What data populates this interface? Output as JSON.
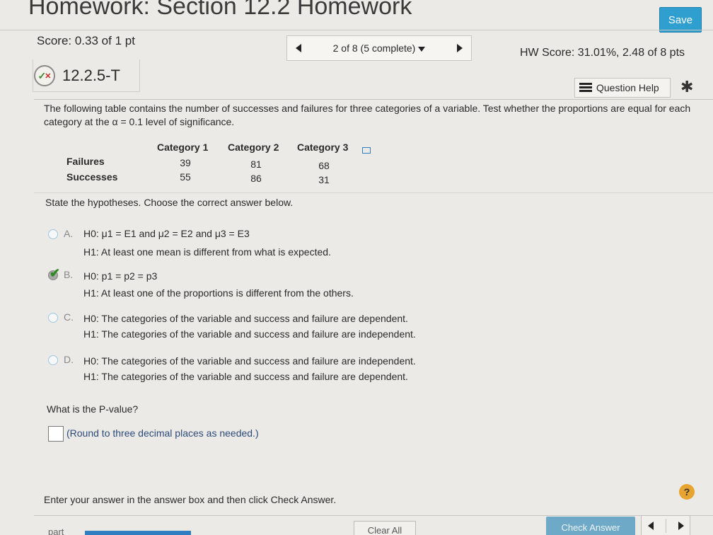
{
  "header": {
    "title": "Homework: Section 12.2 Homework",
    "save_label": "Save"
  },
  "status": {
    "score": "Score: 0.33 of 1 pt",
    "question_nav": "2 of 8 (5 complete)",
    "hw_score": "HW Score: 31.01%, 2.48 of 8 pts"
  },
  "question": {
    "id": "12.2.5-T",
    "help_label": "Question Help",
    "prompt": "The following table contains the number of successes and failures for three categories of a variable. Test whether the proportions are equal for each category at the α = 0.1 level of significance.",
    "table": {
      "columns": [
        "Category 1",
        "Category 2",
        "Category 3"
      ],
      "rows": [
        {
          "label": "Failures",
          "values": [
            "39",
            "81",
            "68"
          ]
        },
        {
          "label": "Successes",
          "values": [
            "55",
            "86",
            "31"
          ]
        }
      ]
    },
    "instruction": "State the hypotheses. Choose the correct answer below.",
    "options": [
      {
        "letter": "A.",
        "h0": "H0: μ1 = E1 and μ2 = E2 and μ3 = E3",
        "h1": "H1: At least one mean is different from what is expected.",
        "selected": false
      },
      {
        "letter": "B.",
        "h0": "H0: p1 = p2 = p3",
        "h1": "H1: At least one of the proportions is different from the others.",
        "selected": true
      },
      {
        "letter": "C.",
        "h0": "H0: The categories of the variable and success and failure are dependent.",
        "h1": "H1: The categories of the variable and success and failure are independent.",
        "selected": false
      },
      {
        "letter": "D.",
        "h0": "H0: The categories of the variable and success and failure are independent.",
        "h1": "H1: The categories of the variable and success and failure are dependent.",
        "selected": false
      }
    ],
    "pvalue_question": "What is the P-value?",
    "pvalue_hint": "(Round to three decimal places as needed.)"
  },
  "footer": {
    "instruction": "Enter your answer in the answer box and then click Check Answer.",
    "part_label": "part",
    "clear_label": "Clear All",
    "check_label": "Check Answer",
    "help_symbol": "?"
  },
  "colors": {
    "accent": "#2f9fd0",
    "check_green": "#2e8a1f",
    "background": "#eceae6"
  }
}
